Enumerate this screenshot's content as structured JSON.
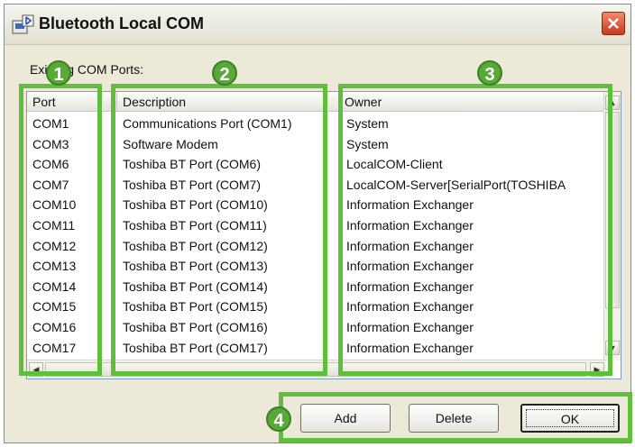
{
  "window": {
    "title": "Bluetooth Local COM"
  },
  "section_label": "Existing COM Ports:",
  "columns": {
    "port": "Port",
    "description": "Description",
    "owner": "Owner"
  },
  "rows": [
    {
      "port": "COM1",
      "description": "Communications Port (COM1)",
      "owner": "System"
    },
    {
      "port": "COM3",
      "description": "Software Modem",
      "owner": "System"
    },
    {
      "port": "COM6",
      "description": "Toshiba BT Port (COM6)",
      "owner": "LocalCOM-Client"
    },
    {
      "port": "COM7",
      "description": "Toshiba BT Port (COM7)",
      "owner": "LocalCOM-Server[SerialPort(TOSHIBA"
    },
    {
      "port": "COM10",
      "description": "Toshiba BT Port (COM10)",
      "owner": "Information Exchanger"
    },
    {
      "port": "COM11",
      "description": "Toshiba BT Port (COM11)",
      "owner": "Information Exchanger"
    },
    {
      "port": "COM12",
      "description": "Toshiba BT Port (COM12)",
      "owner": "Information Exchanger"
    },
    {
      "port": "COM13",
      "description": "Toshiba BT Port (COM13)",
      "owner": "Information Exchanger"
    },
    {
      "port": "COM14",
      "description": "Toshiba BT Port (COM14)",
      "owner": "Information Exchanger"
    },
    {
      "port": "COM15",
      "description": "Toshiba BT Port (COM15)",
      "owner": "Information Exchanger"
    },
    {
      "port": "COM16",
      "description": "Toshiba BT Port (COM16)",
      "owner": "Information Exchanger"
    },
    {
      "port": "COM17",
      "description": "Toshiba BT Port (COM17)",
      "owner": "Information Exchanger"
    }
  ],
  "buttons": {
    "add": "Add",
    "delete": "Delete",
    "ok": "OK"
  },
  "annotations": [
    "1",
    "2",
    "3",
    "4"
  ],
  "colors": {
    "highlight": "#5fbf3c",
    "badge": "#58a937",
    "close": "#d44a2a"
  },
  "icons": {
    "app": "bluetooth-com-icon",
    "close": "close-icon",
    "scroll_up": "arrow-up-icon",
    "scroll_down": "arrow-down-icon",
    "scroll_left": "arrow-left-icon",
    "scroll_right": "arrow-right-icon"
  }
}
